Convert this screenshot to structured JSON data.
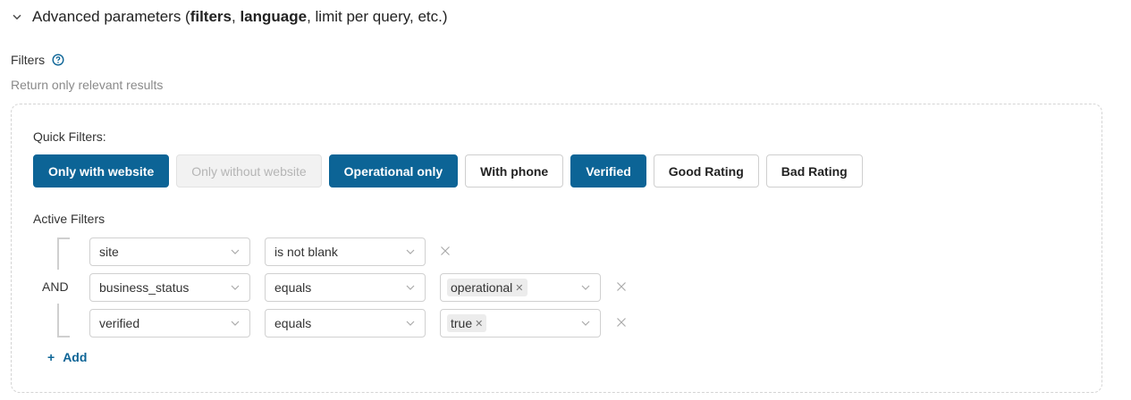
{
  "section": {
    "title_prefix": "Advanced parameters (",
    "title_bold1": "filters",
    "title_sep": ", ",
    "title_bold2": "language",
    "title_suffix": ", limit per query, etc.)"
  },
  "filters": {
    "label": "Filters",
    "description": "Return only relevant results"
  },
  "quick_filters": {
    "label": "Quick Filters:",
    "buttons": [
      {
        "label": "Only with website",
        "state": "active"
      },
      {
        "label": "Only without website",
        "state": "disabled"
      },
      {
        "label": "Operational only",
        "state": "active"
      },
      {
        "label": "With phone",
        "state": "inactive"
      },
      {
        "label": "Verified",
        "state": "active"
      },
      {
        "label": "Good Rating",
        "state": "inactive"
      },
      {
        "label": "Bad Rating",
        "state": "inactive"
      }
    ]
  },
  "active_filters": {
    "label": "Active Filters",
    "logic": "AND",
    "rows": [
      {
        "field": "site",
        "operator": "is not blank",
        "values": []
      },
      {
        "field": "business_status",
        "operator": "equals",
        "values": [
          "operational"
        ]
      },
      {
        "field": "verified",
        "operator": "equals",
        "values": [
          "true"
        ]
      }
    ],
    "add_label": "Add"
  },
  "colors": {
    "accent": "#0c6496",
    "border": "#d0d0d0",
    "muted_text": "#8a8a8a"
  }
}
